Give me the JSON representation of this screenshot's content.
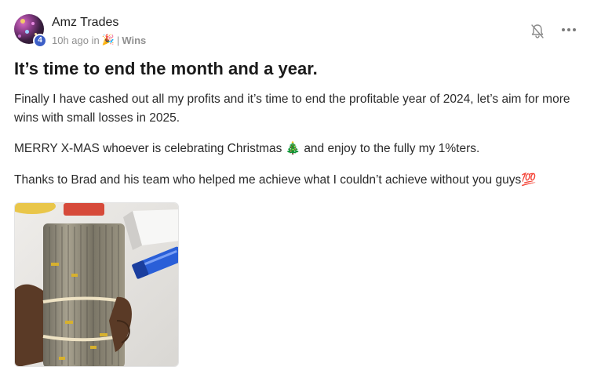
{
  "author": {
    "name": "Amz Trades",
    "level": "4"
  },
  "meta": {
    "time": "10h ago in",
    "category_emoji": "🎉",
    "separator": "|",
    "category": "Wins"
  },
  "icons": {
    "bell": "bell-muted-icon",
    "more": "more-options-icon"
  },
  "post": {
    "title": "It’s time to end the month and a year.",
    "paragraphs": [
      "Finally I have cashed out all my profits and it’s time to end the profitable year of 2024, let’s aim for more wins with small losses in 2025.",
      "MERRY X-MAS whoever is celebrating Christmas 🎄 and enjoy to the fully my 1%ters.",
      "Thanks to Brad and his team who helped me achieve what I couldn’t achieve without you guys💯"
    ]
  },
  "colors": {
    "badge": "#3d5fc7",
    "muted": "#909090"
  }
}
